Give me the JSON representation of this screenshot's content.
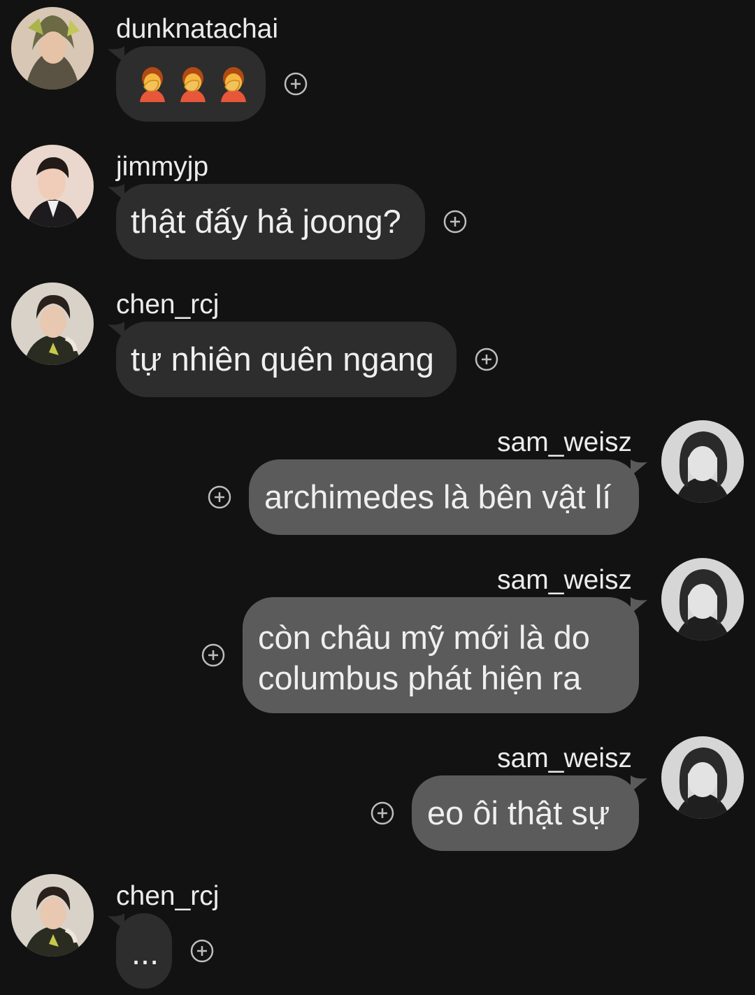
{
  "messages": [
    {
      "user": "dunknatachai",
      "direction": "in",
      "type": "emoji",
      "emoji_count": 3,
      "emoji_name": "facepalm",
      "text": "🤦🤦🤦"
    },
    {
      "user": "jimmyjp",
      "direction": "in",
      "type": "text",
      "lines": [
        "thật đấy hả joong?"
      ]
    },
    {
      "user": "chen_rcj",
      "direction": "in",
      "type": "text",
      "lines": [
        "tự nhiên quên ngang"
      ]
    },
    {
      "user": "sam_weisz",
      "direction": "out",
      "type": "text",
      "lines": [
        "archimedes là bên vật lí"
      ]
    },
    {
      "user": "sam_weisz",
      "direction": "out",
      "type": "text",
      "lines": [
        "còn châu mỹ mới là do",
        "columbus phát hiện ra"
      ]
    },
    {
      "user": "sam_weisz",
      "direction": "out",
      "type": "text",
      "lines": [
        "eo ôi thật sự"
      ]
    },
    {
      "user": "chen_rcj",
      "direction": "in",
      "type": "text",
      "lines": [
        "..."
      ]
    }
  ],
  "colors": {
    "background": "#121212",
    "incoming_bubble": "#2d2d2d",
    "outgoing_bubble": "#5b5b5b",
    "text": "#efefef"
  },
  "icons": {
    "react": "add-reaction-icon",
    "emoji": "facepalm-emoji-icon"
  }
}
